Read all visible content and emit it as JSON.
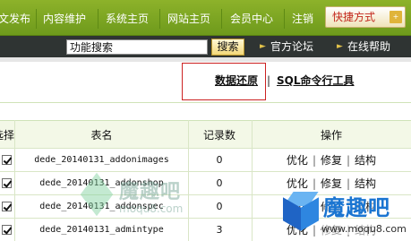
{
  "topnav": {
    "items": [
      "文发布",
      "内容维护",
      "系统主页",
      "网站主页",
      "会员中心",
      "注销"
    ],
    "quick_label": "快捷方式",
    "quick_arrow": "+"
  },
  "searchbar": {
    "input_value": "功能搜索",
    "search_button": "搜索",
    "links": [
      "官方论坛",
      "在线帮助"
    ]
  },
  "tools": {
    "restore_link": "数据还原",
    "separator": "|",
    "sql_link": "SQL命令行工具"
  },
  "table": {
    "headers": [
      "选择",
      "表名",
      "记录数",
      "操作"
    ],
    "rows": [
      {
        "name": "dede_20140131_addonimages",
        "count": "0"
      },
      {
        "name": "dede_20140131_addonshop",
        "count": "0"
      },
      {
        "name": "dede_20140131_addonspec",
        "count": "0"
      },
      {
        "name": "dede_20140131_admintype",
        "count": "3"
      }
    ],
    "ops": [
      "优化",
      "修复",
      "结构"
    ],
    "ops_sep": "|"
  },
  "watermarks": {
    "left_text": "魔趣吧",
    "left_sub": "moqu8.com",
    "right_text": "魔趣吧",
    "right_sub": "www.moqu8.com"
  },
  "colors": {
    "nav_green": "#7aa623",
    "searchbar_dark": "#2f3433",
    "highlight_red": "#cc2222",
    "header_bg": "#f3f8e7"
  }
}
